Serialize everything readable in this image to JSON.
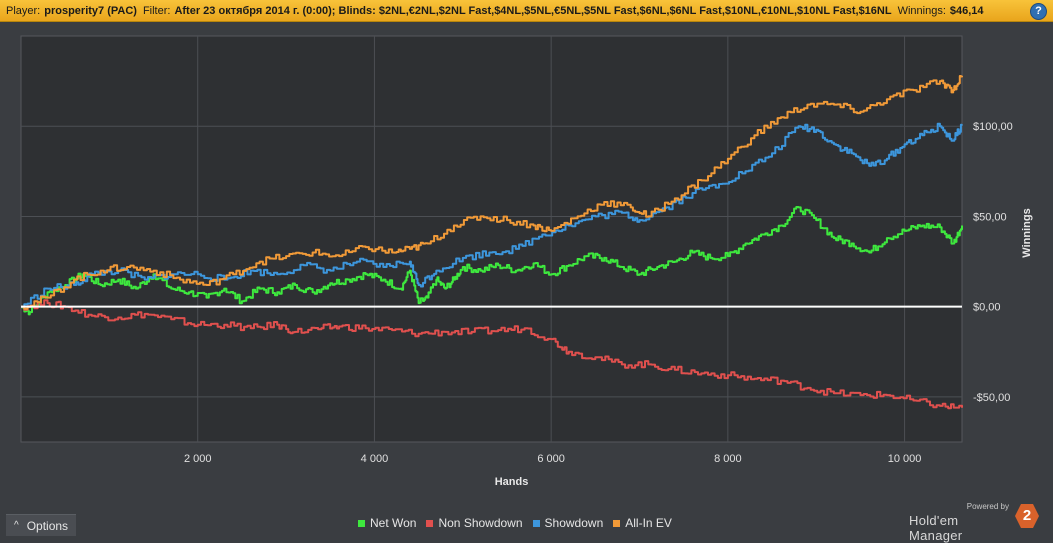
{
  "header": {
    "player_label": "Player:",
    "player_value": "prosperity7 (PAC)",
    "filter_label": "Filter:",
    "filter_value": "After 23 октября 2014 г. (0:00); Blinds: $2NL,€2NL,$2NL Fast,$4NL,$5NL,€5NL,$5NL Fast,$6NL,$6NL Fast,$10NL,€10NL,$10NL Fast,$16NL",
    "winnings_label": "Winnings:",
    "winnings_value": "$46,14",
    "help_icon": "question-icon",
    "help_glyph": "?"
  },
  "footer": {
    "options_label": "Options",
    "options_icon": "chevron-up-icon",
    "options_glyph": "^",
    "powered_by": "Powered by",
    "brand_name": "Hold'em Manager",
    "brand_logo_text": "2"
  },
  "colors": {
    "plot_bg": "#2e3033",
    "grid": "#4c4f54",
    "net_won": "#3ee83e",
    "non_showdown": "#e0504e",
    "showdown": "#3d96dc",
    "all_in_ev": "#f19a38",
    "zero_line": "#ffffff"
  },
  "chart_data": {
    "type": "line",
    "xlabel": "Hands",
    "ylabel": "Winnings",
    "xlim": [
      0,
      10650
    ],
    "ylim": [
      -75,
      150
    ],
    "x_ticks": [
      2000,
      4000,
      6000,
      8000,
      10000
    ],
    "x_tick_labels": [
      "2 000",
      "4 000",
      "6 000",
      "8 000",
      "10 000"
    ],
    "y_ticks": [
      -50,
      0,
      50,
      100
    ],
    "y_tick_labels": [
      "-$50,00",
      "$0,00",
      "$50,00",
      "$100,00"
    ],
    "grid": true,
    "legend_position": "bottom",
    "series": [
      {
        "name": "Net Won",
        "color": "#3ee83e",
        "points": [
          [
            0,
            0
          ],
          [
            100,
            -3
          ],
          [
            300,
            8
          ],
          [
            500,
            12
          ],
          [
            700,
            18
          ],
          [
            900,
            12
          ],
          [
            1100,
            15
          ],
          [
            1300,
            10
          ],
          [
            1500,
            18
          ],
          [
            1700,
            10
          ],
          [
            1900,
            8
          ],
          [
            2100,
            5
          ],
          [
            2300,
            10
          ],
          [
            2500,
            3
          ],
          [
            2700,
            10
          ],
          [
            2900,
            8
          ],
          [
            3100,
            12
          ],
          [
            3300,
            8
          ],
          [
            3500,
            13
          ],
          [
            3700,
            15
          ],
          [
            3900,
            18
          ],
          [
            4100,
            15
          ],
          [
            4300,
            10
          ],
          [
            4400,
            20
          ],
          [
            4500,
            2
          ],
          [
            4600,
            5
          ],
          [
            4700,
            15
          ],
          [
            4800,
            10
          ],
          [
            4900,
            15
          ],
          [
            5000,
            22
          ],
          [
            5200,
            20
          ],
          [
            5400,
            23
          ],
          [
            5600,
            20
          ],
          [
            5800,
            24
          ],
          [
            6000,
            18
          ],
          [
            6200,
            23
          ],
          [
            6400,
            28
          ],
          [
            6600,
            27
          ],
          [
            6800,
            22
          ],
          [
            7000,
            18
          ],
          [
            7200,
            22
          ],
          [
            7400,
            25
          ],
          [
            7600,
            30
          ],
          [
            7800,
            27
          ],
          [
            8000,
            28
          ],
          [
            8200,
            35
          ],
          [
            8400,
            40
          ],
          [
            8600,
            45
          ],
          [
            8800,
            55
          ],
          [
            9000,
            48
          ],
          [
            9200,
            38
          ],
          [
            9400,
            35
          ],
          [
            9600,
            30
          ],
          [
            9800,
            38
          ],
          [
            10000,
            42
          ],
          [
            10200,
            45
          ],
          [
            10400,
            44
          ],
          [
            10550,
            35
          ],
          [
            10650,
            45
          ]
        ]
      },
      {
        "name": "Non Showdown",
        "color": "#e0504e",
        "points": [
          [
            0,
            0
          ],
          [
            300,
            2
          ],
          [
            500,
            0
          ],
          [
            800,
            -5
          ],
          [
            1100,
            -6
          ],
          [
            1400,
            -4
          ],
          [
            1700,
            -7
          ],
          [
            2000,
            -10
          ],
          [
            2300,
            -10
          ],
          [
            2600,
            -12
          ],
          [
            2900,
            -10
          ],
          [
            3100,
            -14
          ],
          [
            3400,
            -12
          ],
          [
            3600,
            -11
          ],
          [
            3900,
            -12
          ],
          [
            4200,
            -13
          ],
          [
            4500,
            -15
          ],
          [
            4800,
            -14
          ],
          [
            5100,
            -14
          ],
          [
            5400,
            -13
          ],
          [
            5700,
            -12
          ],
          [
            6000,
            -18
          ],
          [
            6200,
            -25
          ],
          [
            6500,
            -28
          ],
          [
            6800,
            -32
          ],
          [
            7100,
            -32
          ],
          [
            7400,
            -35
          ],
          [
            7700,
            -37
          ],
          [
            8000,
            -38
          ],
          [
            8300,
            -40
          ],
          [
            8600,
            -41
          ],
          [
            8900,
            -45
          ],
          [
            9200,
            -48
          ],
          [
            9500,
            -49
          ],
          [
            9800,
            -49
          ],
          [
            10100,
            -52
          ],
          [
            10400,
            -55
          ],
          [
            10650,
            -56
          ]
        ]
      },
      {
        "name": "Showdown",
        "color": "#3d96dc",
        "points": [
          [
            0,
            0
          ],
          [
            300,
            10
          ],
          [
            600,
            12
          ],
          [
            800,
            18
          ],
          [
            1100,
            20
          ],
          [
            1400,
            15
          ],
          [
            1700,
            18
          ],
          [
            2000,
            18
          ],
          [
            2300,
            15
          ],
          [
            2600,
            20
          ],
          [
            2900,
            18
          ],
          [
            3200,
            23
          ],
          [
            3500,
            20
          ],
          [
            3800,
            25
          ],
          [
            4100,
            22
          ],
          [
            4400,
            25
          ],
          [
            4500,
            12
          ],
          [
            4700,
            20
          ],
          [
            5000,
            27
          ],
          [
            5300,
            30
          ],
          [
            5600,
            32
          ],
          [
            5900,
            40
          ],
          [
            6200,
            45
          ],
          [
            6500,
            50
          ],
          [
            6800,
            52
          ],
          [
            7000,
            48
          ],
          [
            7300,
            55
          ],
          [
            7600,
            63
          ],
          [
            7900,
            68
          ],
          [
            8200,
            75
          ],
          [
            8500,
            85
          ],
          [
            8800,
            100
          ],
          [
            9000,
            98
          ],
          [
            9200,
            90
          ],
          [
            9400,
            85
          ],
          [
            9600,
            78
          ],
          [
            9800,
            82
          ],
          [
            10000,
            90
          ],
          [
            10200,
            95
          ],
          [
            10400,
            100
          ],
          [
            10550,
            92
          ],
          [
            10650,
            101
          ]
        ]
      },
      {
        "name": "All-In EV",
        "color": "#f19a38",
        "points": [
          [
            0,
            0
          ],
          [
            300,
            5
          ],
          [
            600,
            15
          ],
          [
            900,
            20
          ],
          [
            1200,
            22
          ],
          [
            1500,
            20
          ],
          [
            1800,
            15
          ],
          [
            2100,
            12
          ],
          [
            2400,
            18
          ],
          [
            2700,
            25
          ],
          [
            3000,
            28
          ],
          [
            3300,
            30
          ],
          [
            3600,
            28
          ],
          [
            3900,
            33
          ],
          [
            4200,
            30
          ],
          [
            4400,
            32
          ],
          [
            4600,
            35
          ],
          [
            4900,
            45
          ],
          [
            5200,
            50
          ],
          [
            5500,
            48
          ],
          [
            5800,
            45
          ],
          [
            6000,
            42
          ],
          [
            6300,
            50
          ],
          [
            6600,
            58
          ],
          [
            6900,
            55
          ],
          [
            7100,
            50
          ],
          [
            7400,
            60
          ],
          [
            7700,
            70
          ],
          [
            8000,
            82
          ],
          [
            8300,
            95
          ],
          [
            8600,
            105
          ],
          [
            8900,
            112
          ],
          [
            9200,
            112
          ],
          [
            9500,
            108
          ],
          [
            9800,
            115
          ],
          [
            10100,
            120
          ],
          [
            10400,
            125
          ],
          [
            10550,
            120
          ],
          [
            10650,
            128
          ]
        ]
      }
    ]
  }
}
